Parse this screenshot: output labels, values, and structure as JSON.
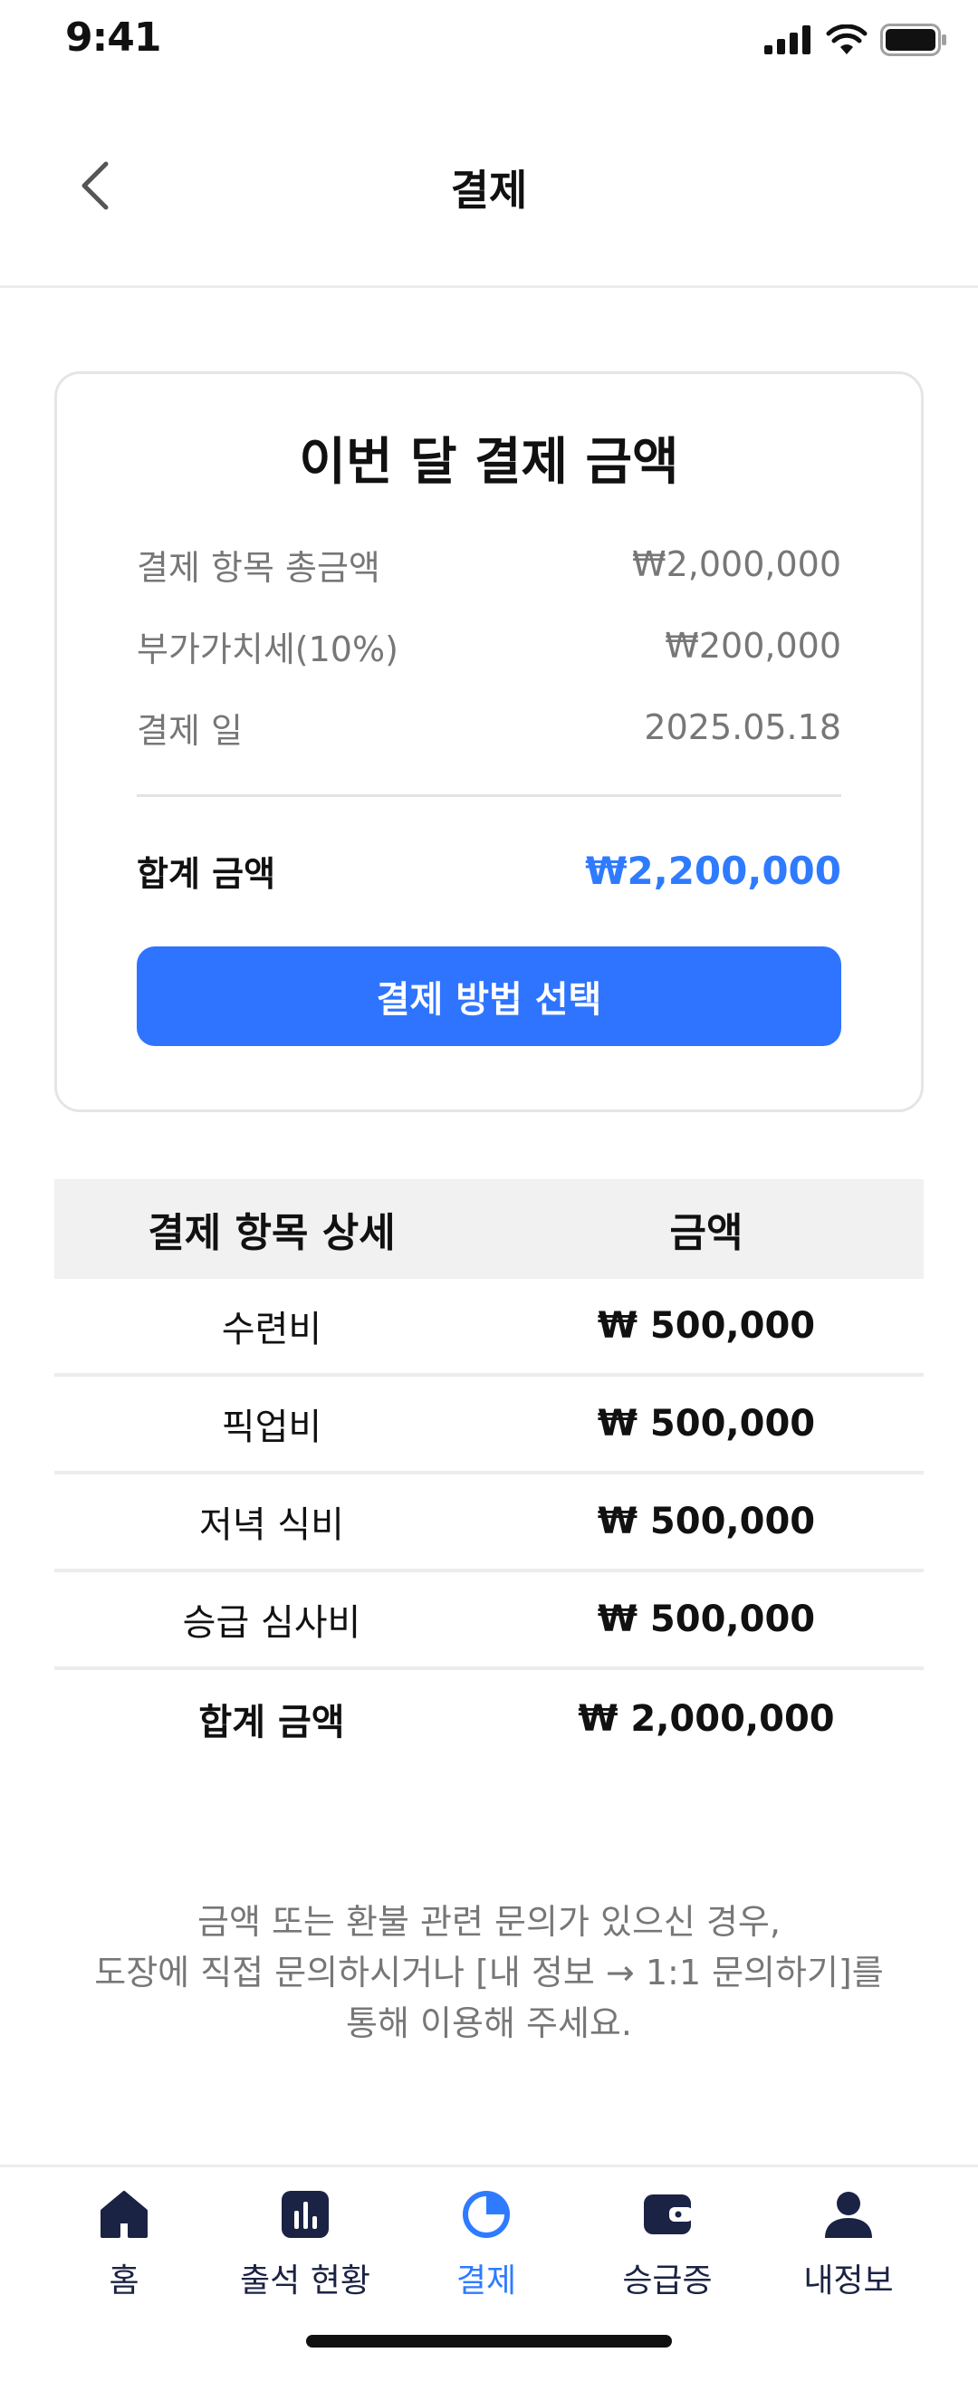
{
  "status_bar": {
    "time": "9:41"
  },
  "header": {
    "title": "결제"
  },
  "summary": {
    "title": "이번 달 결제 금액",
    "rows": [
      {
        "label": "결제 항목 총금액",
        "value": "₩2,000,000"
      },
      {
        "label": "부가가치세(10%)",
        "value": "₩200,000"
      },
      {
        "label": "결제 일",
        "value": "2025.05.18"
      }
    ],
    "total_label": "합계 금액",
    "total_value": "₩2,200,000",
    "pay_button_label": "결제 방법 선택"
  },
  "detail_table": {
    "headers": [
      "결제 항목 상세",
      "금액"
    ],
    "rows": [
      {
        "name": "수련비",
        "amount": "₩ 500,000"
      },
      {
        "name": "픽업비",
        "amount": "₩ 500,000"
      },
      {
        "name": "저녁 식비",
        "amount": "₩ 500,000"
      },
      {
        "name": "승급 심사비",
        "amount": "₩ 500,000"
      },
      {
        "name": "합계 금액",
        "amount": "₩ 2,000,000"
      }
    ]
  },
  "notice": {
    "lines": [
      "금액 또는 환불 관련 문의가 있으신 경우,",
      "도장에 직접 문의하시거나 [내 정보 → 1:1 문의하기]를",
      "통해 이용해 주세요."
    ]
  },
  "bottom_nav": {
    "items": [
      {
        "label": "홈",
        "icon": "home-icon"
      },
      {
        "label": "출석 현황",
        "icon": "bar-chart-icon"
      },
      {
        "label": "결제",
        "icon": "pie-chart-icon",
        "active": true
      },
      {
        "label": "승급증",
        "icon": "wallet-icon"
      },
      {
        "label": "내정보",
        "icon": "user-icon"
      }
    ]
  },
  "colors": {
    "accent": "#2f7bff",
    "button": "#2f74ff",
    "nav_icon": "#1b2344"
  }
}
